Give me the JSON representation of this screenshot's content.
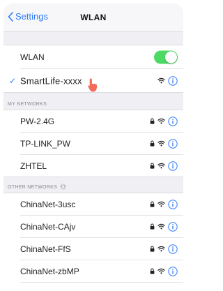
{
  "nav": {
    "back_label": "Settings",
    "title": "WLAN"
  },
  "wlan": {
    "label": "WLAN",
    "enabled": true,
    "toggle_color": "#4cd964"
  },
  "current_network": {
    "name": "SmartLife-xxxx",
    "connected": true,
    "icons": [
      "wifi-icon",
      "info-icon"
    ]
  },
  "my_networks": {
    "header": "MY NETWORKS",
    "items": [
      {
        "name": "PW-2.4G",
        "icons": [
          "lock-icon",
          "wifi-icon",
          "info-icon"
        ]
      },
      {
        "name": "TP-LINK_PW",
        "icons": [
          "lock-icon",
          "wifi-icon",
          "info-icon"
        ]
      },
      {
        "name": "ZHTEL",
        "icons": [
          "lock-icon",
          "wifi-icon",
          "info-icon"
        ]
      }
    ]
  },
  "other_networks": {
    "header": "OTHER NETWORKS",
    "items": [
      {
        "name": "ChinaNet-3usc",
        "icons": [
          "lock-icon",
          "wifi-icon",
          "info-icon"
        ]
      },
      {
        "name": "ChinaNet-CAjv",
        "icons": [
          "lock-icon",
          "wifi-icon",
          "info-icon"
        ]
      },
      {
        "name": "ChinaNet-FfS",
        "icons": [
          "lock-icon",
          "wifi-icon",
          "info-icon"
        ]
      },
      {
        "name": "ChinaNet-zbMP",
        "icons": [
          "lock-icon",
          "wifi-icon",
          "info-icon"
        ]
      }
    ]
  },
  "colors": {
    "accent": "#2f7bf6",
    "background": "#efeff4",
    "pointer_hand": "#f26b5b"
  }
}
